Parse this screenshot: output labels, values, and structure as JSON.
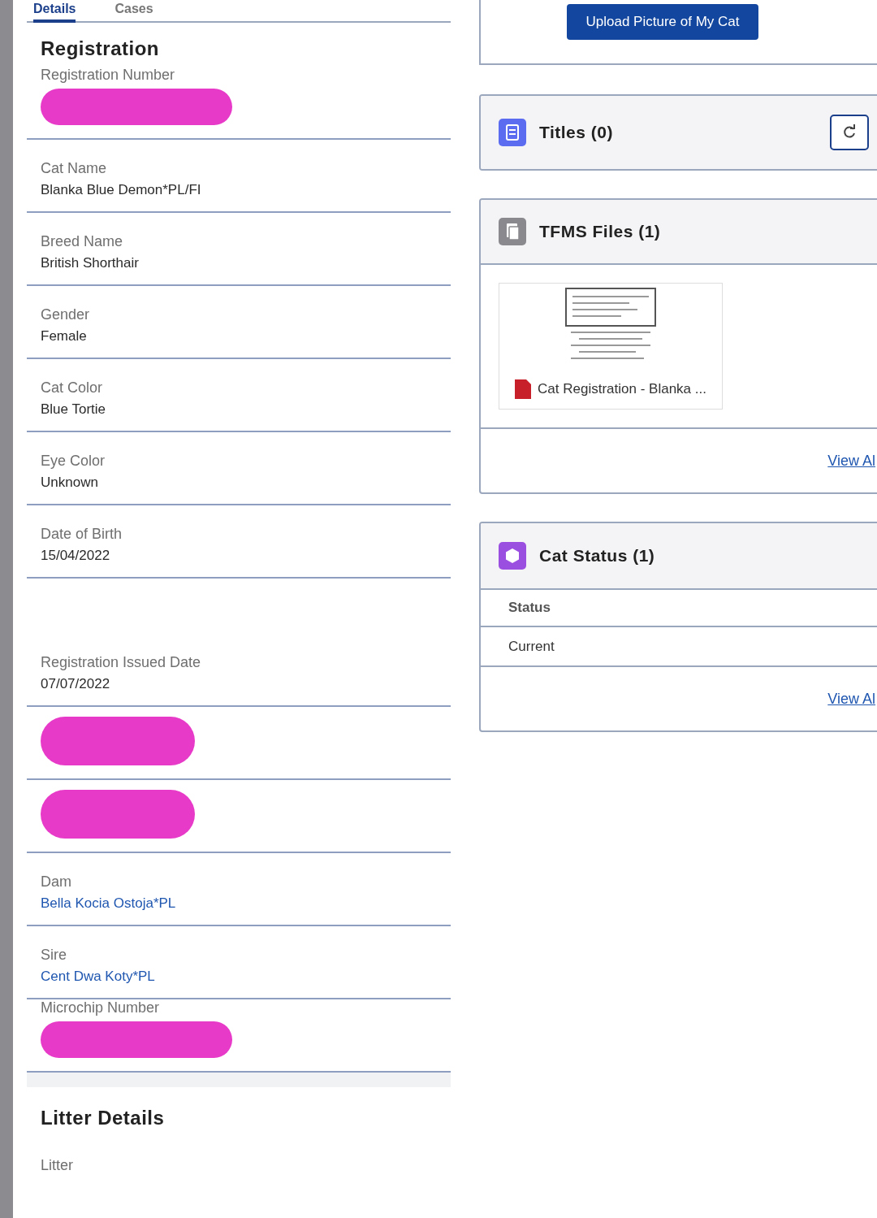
{
  "tabs": [
    {
      "label": "Details",
      "selected": true
    },
    {
      "label": "Cases",
      "selected": false
    }
  ],
  "registration": {
    "title": "Registration",
    "fields": [
      {
        "kind": "redacted",
        "label": "Registration Number"
      },
      {
        "kind": "field",
        "label": "Cat Name",
        "value": "Blanka Blue Demon*PL/FI"
      },
      {
        "kind": "field",
        "label": "Breed Name",
        "value": "British Shorthair"
      },
      {
        "kind": "field",
        "label": "Gender",
        "value": "Female"
      },
      {
        "kind": "field",
        "label": "Cat Color",
        "value": "Blue Tortie"
      },
      {
        "kind": "field",
        "label": "Eye Color",
        "value": "Unknown"
      },
      {
        "kind": "field",
        "label": "Date of Birth",
        "value": "15/04/2022"
      },
      {
        "kind": "tall",
        "label": "Registration Issued Date",
        "value": "07/07/2022"
      },
      {
        "kind": "hidden"
      },
      {
        "kind": "hidden"
      },
      {
        "kind": "link",
        "label": "Dam",
        "value": "Bella Kocia Ostoja*PL"
      },
      {
        "kind": "link",
        "label": "Sire",
        "value": "Cent Dwa Koty*PL"
      },
      {
        "kind": "redacted",
        "label": "Microchip Number"
      }
    ]
  },
  "litter": {
    "title": "Litter Details",
    "fields": [
      {
        "label": "Litter"
      }
    ]
  },
  "upload_button": "Upload Picture of My Cat",
  "titles_card": {
    "title": "Titles (0)"
  },
  "files_card": {
    "title": "TFMS Files (1)",
    "files": [
      {
        "name": "Cat Registration - Blanka ..."
      }
    ],
    "footer_link": "View Al"
  },
  "status_card": {
    "title": "Cat Status (1)",
    "column": "Status",
    "rows": [
      "Current"
    ],
    "footer_link": "View Al"
  }
}
